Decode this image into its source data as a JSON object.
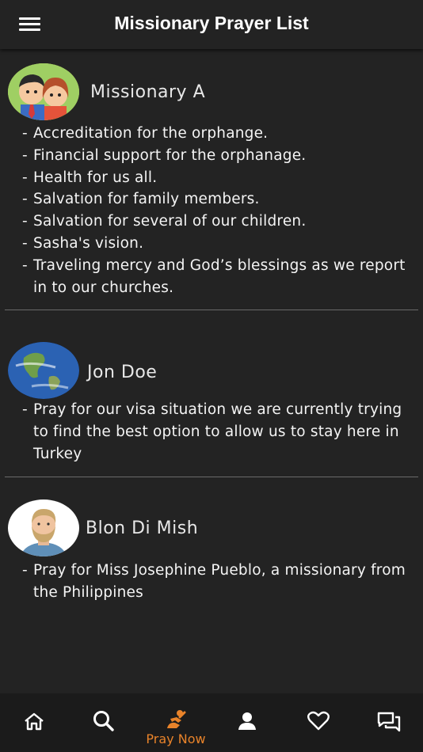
{
  "header": {
    "title": "Missionary Prayer List"
  },
  "entries": [
    {
      "name": "Missionary A",
      "items": [
        "Accreditation for the orphange.",
        "Financial support for the orphanage.",
        "Health for us all.",
        "Salvation for family members.",
        "Salvation for several of our children.",
        "Sasha's vision.",
        "Traveling mercy and God’s blessings as we report in to our churches."
      ]
    },
    {
      "name": "Jon Doe",
      "items": [
        "Pray for our visa situation we are currently trying to find the best option to allow us to stay here in Turkey"
      ]
    },
    {
      "name": "Blon Di Mish",
      "items": [
        "Pray for Miss Josephine Pueblo, a missionary from the Philippines"
      ]
    }
  ],
  "tabbar": {
    "pray_now_label": "Pray Now",
    "active_color": "#e8832a"
  }
}
